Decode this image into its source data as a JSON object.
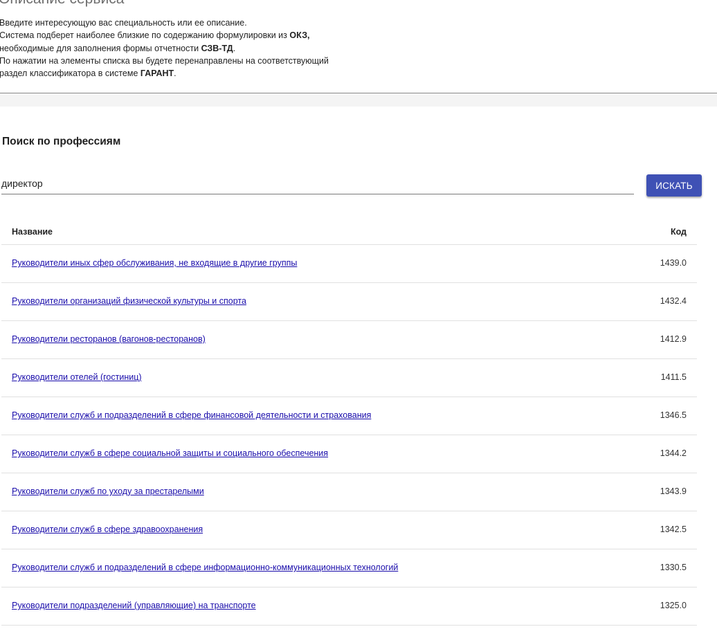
{
  "description": {
    "title": "Описание сервиса",
    "line1": "Введите интересующую вас специальность или ее описание.",
    "line2_pre": "Система подберет наиболее близкие по содержанию формулировки из ",
    "line2_bold": "ОКЗ,",
    "line3_pre": "необходимые для заполнения формы отчетности ",
    "line3_bold": "СЗВ-ТД",
    "line3_post": ".",
    "line4": "По нажатии на элементы списка вы будете перенаправлены на соответствующий",
    "line5_pre": "раздел классификатора в системе ",
    "line5_bold": "ГАРАНТ",
    "line5_post": "."
  },
  "search": {
    "title": "Поиск по профессиям",
    "value": "директор",
    "button_label": "ИСКАТЬ"
  },
  "table": {
    "header_name": "Название",
    "header_code": "Код",
    "rows": [
      {
        "name": "Руководители иных сфер обслуживания, не входящие в другие группы",
        "code": "1439.0"
      },
      {
        "name": "Руководители организаций физической культуры и спорта",
        "code": "1432.4"
      },
      {
        "name": "Руководители ресторанов (вагонов-ресторанов)",
        "code": "1412.9"
      },
      {
        "name": "Руководители отелей (гостиниц)",
        "code": "1411.5"
      },
      {
        "name": "Руководители служб и подразделений в сфере финансовой деятельности и страхования",
        "code": "1346.5"
      },
      {
        "name": "Руководители служб в сфере социальной защиты и социального обеспечения",
        "code": "1344.2"
      },
      {
        "name": "Руководители служб по уходу за престарелыми",
        "code": "1343.9"
      },
      {
        "name": "Руководители служб в сфере здравоохранения",
        "code": "1342.5"
      },
      {
        "name": "Руководители служб и подразделений в сфере информационно-коммуникационных технологий",
        "code": "1330.5"
      },
      {
        "name": "Руководители подразделений (управляющие) на транспорте",
        "code": "1325.0"
      }
    ]
  },
  "colors": {
    "accent": "#3f51b5",
    "link": "#1a0dab"
  }
}
